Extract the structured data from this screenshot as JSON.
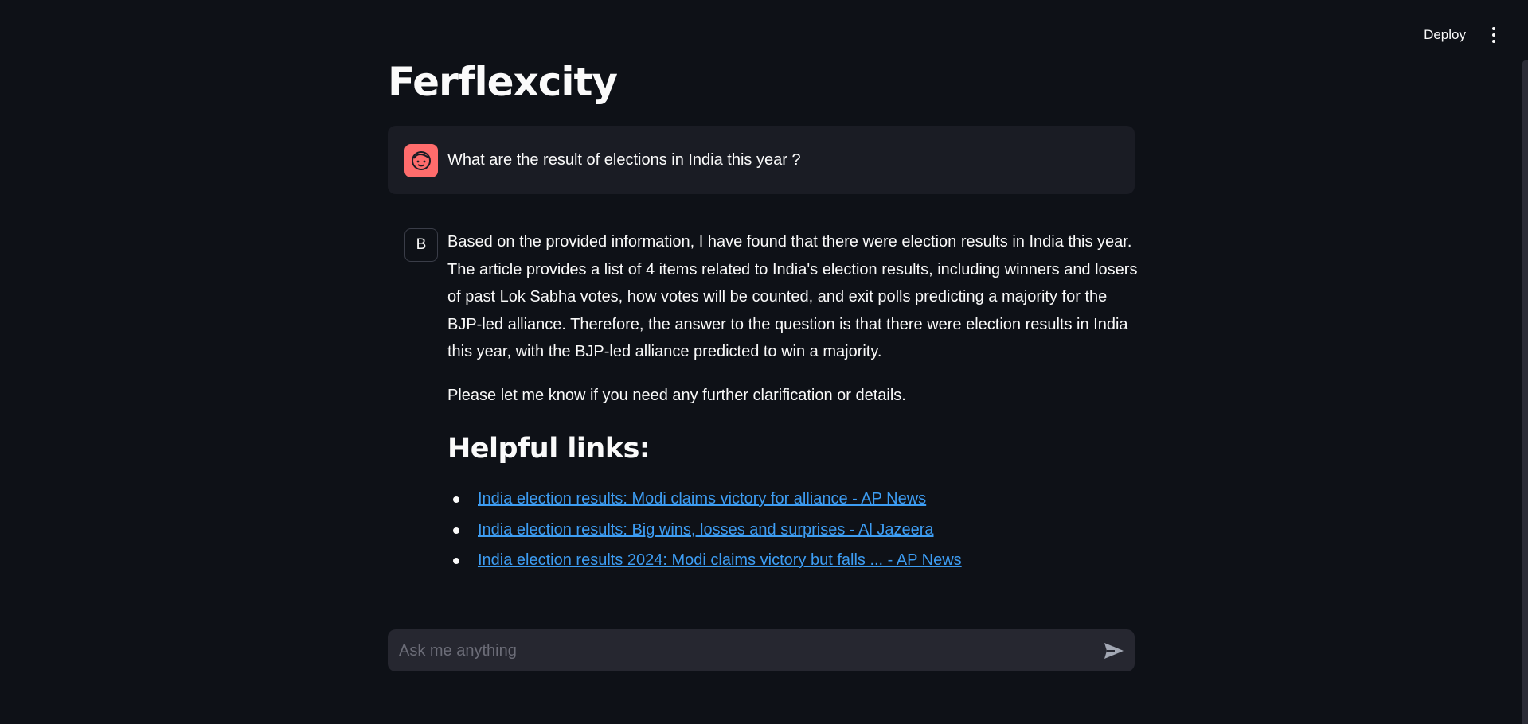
{
  "header": {
    "deploy_label": "Deploy"
  },
  "app": {
    "title": "Ferflexcity"
  },
  "user_message": {
    "text": "What are the result of elections in India this year ?",
    "avatar_icon": "face-icon",
    "avatar_color": "#ff6c6c"
  },
  "bot_message": {
    "avatar_label": "B",
    "paragraphs": [
      "Based on the provided information, I have found that there were election results in India this year. The article provides a list of 4 items related to India's election results, including winners and losers of past Lok Sabha votes, how votes will be counted, and exit polls predicting a majority for the BJP-led alliance. Therefore, the answer to the question is that there were election results in India this year, with the BJP-led alliance predicted to win a majority.",
      "Please let me know if you need any further clarification or details."
    ],
    "links_heading": "Helpful links:",
    "links": [
      "India election results: Modi claims victory for alliance - AP News",
      "India election results: Big wins, losses and surprises - Al Jazeera",
      "India election results 2024: Modi claims victory but falls ... - AP News"
    ]
  },
  "chat_input": {
    "placeholder": "Ask me anything",
    "value": ""
  },
  "colors": {
    "background": "#0e1117",
    "link": "#3d9df3",
    "input_bg": "#262730"
  }
}
